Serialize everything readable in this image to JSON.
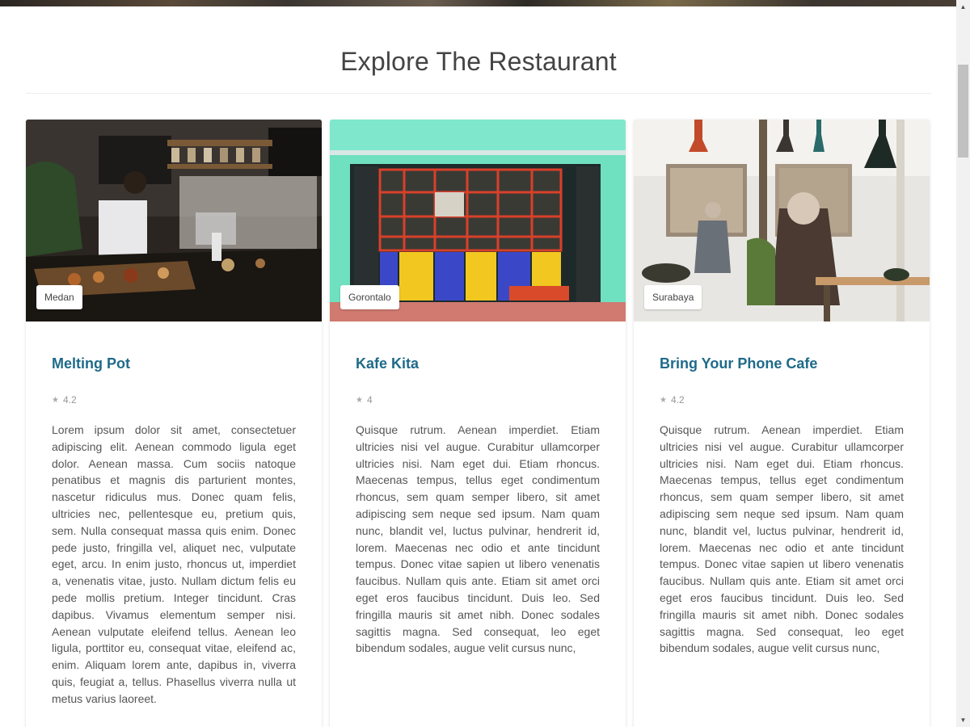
{
  "section": {
    "title": "Explore The Restaurant"
  },
  "restaurants": [
    {
      "city": "Medan",
      "name": "Melting Pot",
      "rating": "4.2",
      "description": "Lorem ipsum dolor sit amet, consectetuer adipiscing elit. Aenean commodo ligula eget dolor. Aenean massa. Cum sociis natoque penatibus et magnis dis parturient montes, nascetur ridiculus mus. Donec quam felis, ultricies nec, pellentesque eu, pretium quis, sem. Nulla consequat massa quis enim. Donec pede justo, fringilla vel, aliquet nec, vulputate eget, arcu. In enim justo, rhoncus ut, imperdiet a, venenatis vitae, justo. Nullam dictum felis eu pede mollis pretium. Integer tincidunt. Cras dapibus. Vivamus elementum semper nisi. Aenean vulputate eleifend tellus. Aenean leo ligula, porttitor eu, consequat vitae, eleifend ac, enim. Aliquam lorem ante, dapibus in, viverra quis, feugiat a, tellus. Phasellus viverra nulla ut metus varius laoreet."
    },
    {
      "city": "Gorontalo",
      "name": "Kafe Kita",
      "rating": "4",
      "description": "Quisque rutrum. Aenean imperdiet. Etiam ultricies nisi vel augue. Curabitur ullamcorper ultricies nisi. Nam eget dui. Etiam rhoncus. Maecenas tempus, tellus eget condimentum rhoncus, sem quam semper libero, sit amet adipiscing sem neque sed ipsum. Nam quam nunc, blandit vel, luctus pulvinar, hendrerit id, lorem. Maecenas nec odio et ante tincidunt tempus. Donec vitae sapien ut libero venenatis faucibus. Nullam quis ante. Etiam sit amet orci eget eros faucibus tincidunt. Duis leo. Sed fringilla mauris sit amet nibh. Donec sodales sagittis magna. Sed consequat, leo eget bibendum sodales, augue velit cursus nunc,"
    },
    {
      "city": "Surabaya",
      "name": "Bring Your Phone Cafe",
      "rating": "4.2",
      "description": "Quisque rutrum. Aenean imperdiet. Etiam ultricies nisi vel augue. Curabitur ullamcorper ultricies nisi. Nam eget dui. Etiam rhoncus. Maecenas tempus, tellus eget condimentum rhoncus, sem quam semper libero, sit amet adipiscing sem neque sed ipsum. Nam quam nunc, blandit vel, luctus pulvinar, hendrerit id, lorem. Maecenas nec odio et ante tincidunt tempus. Donec vitae sapien ut libero venenatis faucibus. Nullam quis ante. Etiam sit amet orci eget eros faucibus tincidunt. Duis leo. Sed fringilla mauris sit amet nibh. Donec sodales sagittis magna. Sed consequat, leo eget bibendum sodales, augue velit cursus nunc,"
    }
  ],
  "icons": {
    "rating": "star-icon",
    "scroll_up": "chevron-up-icon",
    "scroll_down": "chevron-down-icon"
  },
  "colors": {
    "restaurant_name": "#1e6a8a",
    "title": "#444444"
  }
}
